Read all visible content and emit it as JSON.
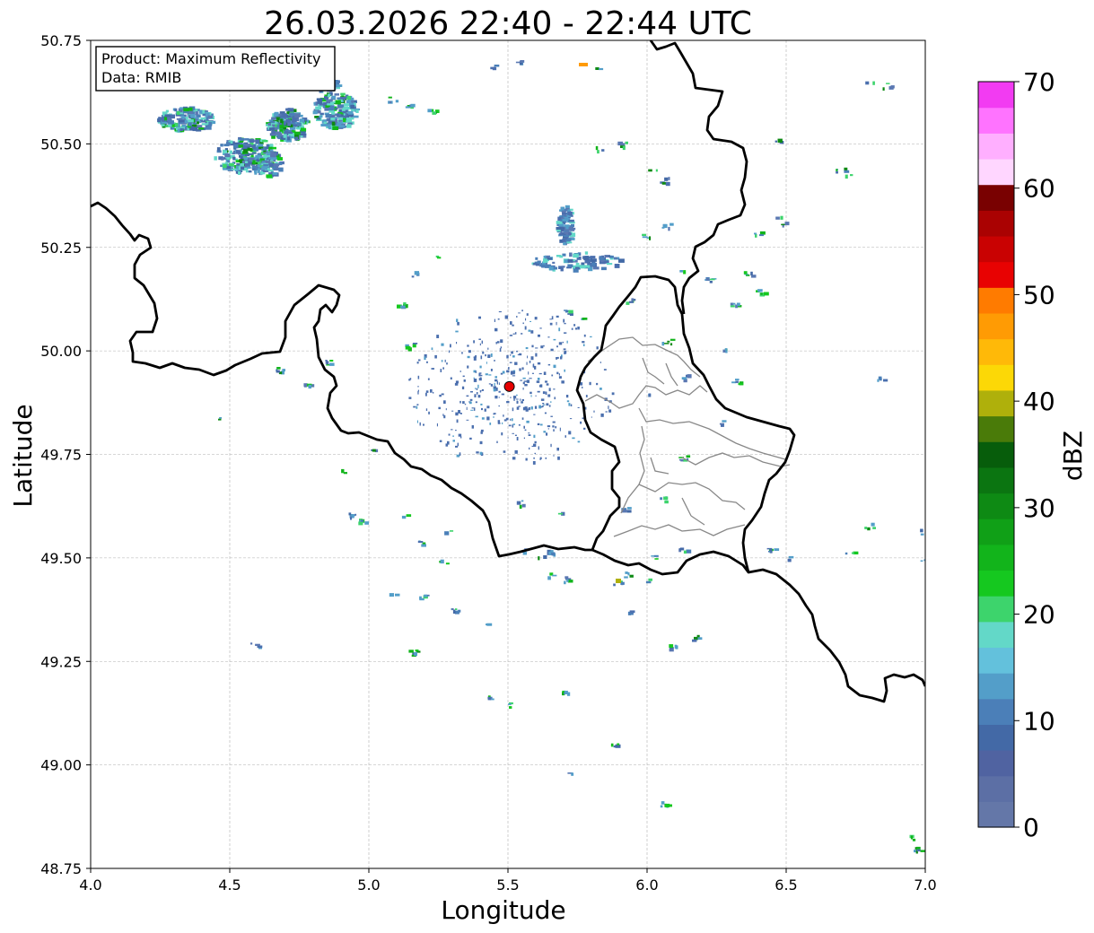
{
  "title": "26.03.2026 22:40 - 22:44 UTC",
  "info": {
    "product": "Product: Maximum Reflectivity",
    "source": "Data: RMIB"
  },
  "colorbar": {
    "label": "dBZ",
    "ticks": [
      "0",
      "10",
      "20",
      "30",
      "40",
      "50",
      "60",
      "70"
    ],
    "colors": [
      "#6477a8",
      "#5c6fa5",
      "#5063a1",
      "#4369a6",
      "#4b7fb8",
      "#539ec9",
      "#63c1dc",
      "#63d8c8",
      "#3dd46c",
      "#15c81f",
      "#12b41b",
      "#10a017",
      "#0e8a14",
      "#0b7511",
      "#075d0b",
      "#4a7b09",
      "#afb00b",
      "#fcd806",
      "#ffb908",
      "#ff9b04",
      "#ff7b00",
      "#e80202",
      "#c90202",
      "#aa0202",
      "#790101",
      "#ffd6ff",
      "#ffafff",
      "#ff73ff",
      "#f23bf2"
    ]
  },
  "chart_data": {
    "type": "map",
    "title": "26.03.2026 22:40 - 22:44 UTC",
    "xlabel": "Longitude",
    "ylabel": "Latitude",
    "xlim": [
      4.0,
      7.0
    ],
    "ylim": [
      48.75,
      50.75
    ],
    "xticks": [
      "4.0",
      "4.5",
      "5.0",
      "5.5",
      "6.0",
      "6.5",
      "7.0"
    ],
    "yticks": [
      "48.75",
      "49.00",
      "49.25",
      "49.50",
      "49.75",
      "50.00",
      "50.25",
      "50.50",
      "50.75"
    ],
    "grid": true,
    "radar_site": {
      "lon": 5.505,
      "lat": 49.914
    },
    "colorbar_range": [
      0,
      70
    ],
    "colorbar_unit": "dBZ"
  }
}
